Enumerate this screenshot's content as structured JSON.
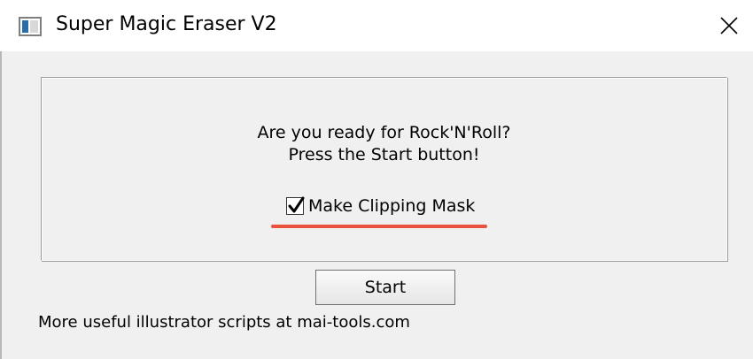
{
  "window": {
    "title": "Super Magic Eraser V2",
    "icon": "app-window-icon",
    "close_icon": "close-icon"
  },
  "panel": {
    "message_line1": "Are you ready for Rock'N'Roll?",
    "message_line2": "Press the Start button!",
    "checkbox": {
      "label": "Make Clipping Mask",
      "checked": true
    },
    "highlight_color": "#e8523e"
  },
  "start_button": {
    "label": "Start"
  },
  "footer": {
    "text": "More useful illustrator scripts at mai-tools.com"
  }
}
